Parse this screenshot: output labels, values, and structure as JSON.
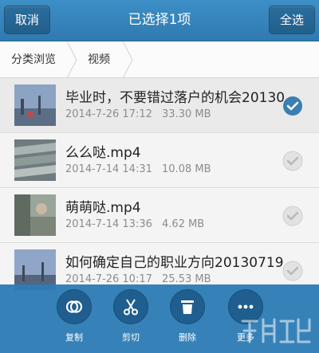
{
  "header": {
    "cancel_label": "取消",
    "title": "已选择1项",
    "select_all_label": "全选"
  },
  "breadcrumb": {
    "items": [
      "分类浏览",
      "视频"
    ]
  },
  "files": [
    {
      "name": "毕业时，不要错过落户的机会20130",
      "date": "2014-7-26 17:12",
      "size": "33.30 MB",
      "selected": true
    },
    {
      "name": "么么哒.mp4",
      "date": "2014-7-14 14:31",
      "size": "10.08 MB",
      "selected": false
    },
    {
      "name": "萌萌哒.mp4",
      "date": "2014-7-14 13:36",
      "size": "4.62 MB",
      "selected": false
    },
    {
      "name": "如何确定自己的职业方向20130719",
      "date": "2014-7-26 10:17",
      "size": "25.53 MB",
      "selected": false
    }
  ],
  "toolbar": {
    "copy_label": "复制",
    "cut_label": "剪切",
    "delete_label": "删除",
    "more_label": "更多"
  },
  "icons": {
    "copy": "copy-icon",
    "cut": "scissors-icon",
    "delete": "trash-icon",
    "more": "more-dots-icon",
    "check_on": "check-selected-icon",
    "check_off": "check-unselected-icon"
  },
  "colors": {
    "header": "#3a89c1",
    "accent": "#2e7db5",
    "check_selected": "#3a7fb0",
    "check_unselected": "#b8b8b8"
  }
}
